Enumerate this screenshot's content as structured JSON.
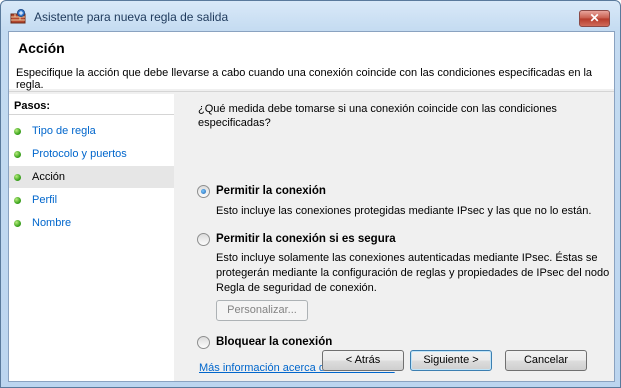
{
  "window": {
    "title": "Asistente para nueva regla de salida",
    "close_glyph": "✕",
    "icon": "firewall-wizard-icon"
  },
  "header": {
    "title": "Acción",
    "description": "Especifique la acción que debe llevarse a cabo cuando una conexión coincide con las condiciones especificadas en la regla."
  },
  "steps": {
    "title": "Pasos:",
    "items": [
      {
        "label": "Tipo de regla",
        "active": false
      },
      {
        "label": "Protocolo y puertos",
        "active": false
      },
      {
        "label": "Acción",
        "active": true
      },
      {
        "label": "Perfil",
        "active": false
      },
      {
        "label": "Nombre",
        "active": false
      }
    ]
  },
  "main": {
    "question": "¿Qué medida debe tomarse si una conexión coincide con las condiciones especificadas?",
    "options": [
      {
        "label": "Permitir la conexión",
        "description": "Esto incluye las conexiones protegidas mediante IPsec y las que no lo están.",
        "selected": true
      },
      {
        "label": "Permitir la conexión si es segura",
        "description": "Esto incluye solamente las conexiones autenticadas mediante IPsec. Éstas se protegerán mediante la configuración de reglas y propiedades de IPsec del nodo Regla de seguridad de conexión.",
        "selected": false
      },
      {
        "label": "Bloquear la conexión",
        "description": "",
        "selected": false
      }
    ],
    "customize_label": "Personalizar...",
    "more_info_link": "Más información acerca de las acciones"
  },
  "buttons": {
    "back": "< Atrás",
    "next": "Siguiente >",
    "cancel": "Cancelar"
  }
}
